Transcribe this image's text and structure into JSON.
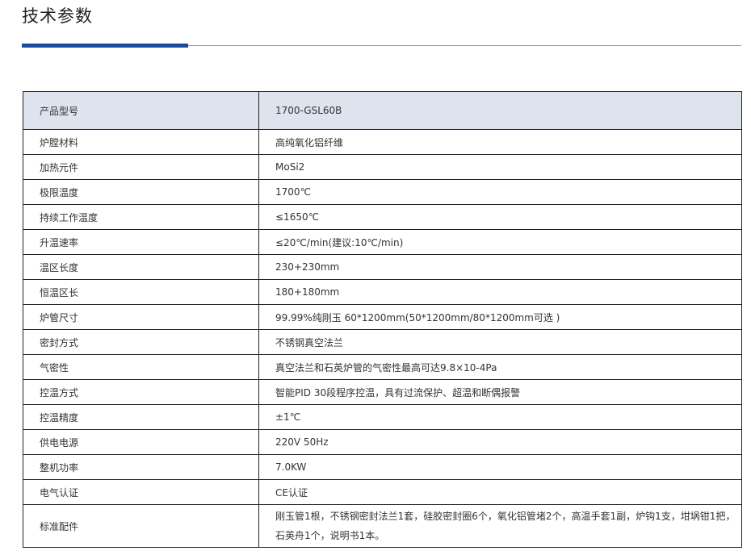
{
  "section": {
    "title": "技术参数"
  },
  "table": {
    "header": {
      "label": "产品型号",
      "value": "1700-GSL60B"
    },
    "rows": [
      {
        "label": "炉膛材料",
        "value": "高纯氧化铝纤维"
      },
      {
        "label": "加热元件",
        "value": "MoSi2"
      },
      {
        "label": "极限温度",
        "value": "1700℃"
      },
      {
        "label": "持续工作温度",
        "value": "≤1650℃"
      },
      {
        "label": "升温速率",
        "value": "≤20℃/min(建议:10℃/min)"
      },
      {
        "label": "温区长度",
        "value": "230+230mm"
      },
      {
        "label": "恒温区长",
        "value": "180+180mm"
      },
      {
        "label": "炉管尺寸",
        "value": "99.99%纯刚玉 60*1200mm(50*1200mm/80*1200mm可选 )"
      },
      {
        "label": "密封方式",
        "value": "不锈钢真空法兰"
      },
      {
        "label": "气密性",
        "value": "真空法兰和石英炉管的气密性最高可达9.8×10-4Pa"
      },
      {
        "label": "控温方式",
        "value": "智能PID 30段程序控温，具有过流保护、超温和断偶报警"
      },
      {
        "label": "控温精度",
        "value": "±1℃"
      },
      {
        "label": "供电电源",
        "value": "220V  50Hz"
      },
      {
        "label": "整机功率",
        "value": "7.0KW"
      },
      {
        "label": "电气认证",
        "value": "CE认证"
      },
      {
        "label": "标准配件",
        "value": "刚玉管1根，不锈钢密封法兰1套，硅胶密封圈6个，氧化铝管堵2个，高温手套1副，炉钩1支，坩埚钳1把，石英舟1个，说明书1本。"
      }
    ]
  },
  "colors": {
    "accent": "#1a4b9c",
    "header_bg": "#dfe3ee"
  }
}
